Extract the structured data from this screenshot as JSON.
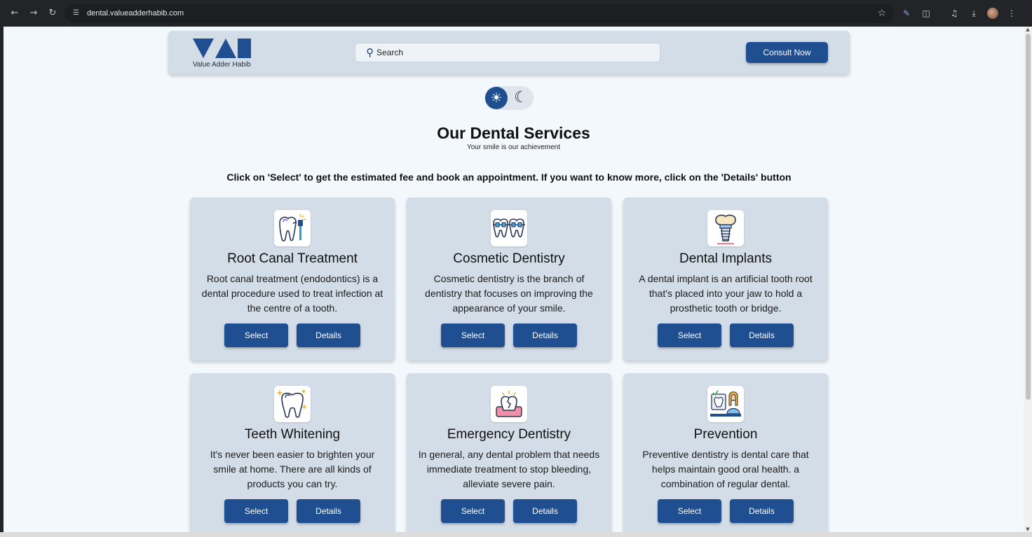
{
  "browser": {
    "url": "dental.valueadderhabib.com",
    "icons": [
      "back-arrow-icon",
      "forward-arrow-icon",
      "reload-icon",
      "site-settings-icon",
      "bookmark-star-icon",
      "pen-extension-icon",
      "extensions-icon",
      "media-control-icon",
      "download-icon",
      "profile-avatar",
      "more-menu-icon"
    ]
  },
  "header": {
    "logo_text": "Value Adder Habib",
    "search_placeholder": "Search",
    "consult_label": "Consult Now"
  },
  "theme_toggle": {
    "mode": "light",
    "icons": [
      "sun-icon",
      "moon-icon"
    ]
  },
  "main": {
    "title": "Our Dental Services",
    "subtitle": "Your smile is our achievement",
    "instructions": "Click on 'Select' to get the estimated fee and book an appointment. If you want to know more, click on the 'Details' button"
  },
  "services": [
    {
      "title": "Root Canal Treatment",
      "description": "Root canal treatment (endodontics) is a dental procedure used to treat infection at the centre of a tooth.",
      "select_label": "Select",
      "details_label": "Details",
      "icon": "root-canal-icon"
    },
    {
      "title": "Cosmetic Dentistry",
      "description": "Cosmetic dentistry is the branch of dentistry that focuses on improving the appearance of your smile.",
      "select_label": "Select",
      "details_label": "Details",
      "icon": "braces-icon"
    },
    {
      "title": "Dental Implants",
      "description": "A dental implant is an artificial tooth root that's placed into your jaw to hold a prosthetic tooth or bridge.",
      "select_label": "Select",
      "details_label": "Details",
      "icon": "implant-icon"
    },
    {
      "title": "Teeth Whitening",
      "description": "It's never been easier to brighten your smile at home. There are all kinds of products you can try.",
      "select_label": "Select",
      "details_label": "Details",
      "icon": "sparkling-tooth-icon"
    },
    {
      "title": "Emergency Dentistry",
      "description": "In general, any dental problem that needs immediate treatment to stop bleeding, alleviate severe pain.",
      "select_label": "Select",
      "details_label": "Details",
      "icon": "broken-tooth-icon"
    },
    {
      "title": "Prevention",
      "description": "Preventive dentistry is dental care that helps maintain good oral health. a combination of regular dental.",
      "select_label": "Select",
      "details_label": "Details",
      "icon": "dentist-icon"
    }
  ],
  "colors": {
    "accent": "#1f4e91",
    "card_bg": "#d3dde8",
    "page_bg": "#f3f8fd"
  }
}
